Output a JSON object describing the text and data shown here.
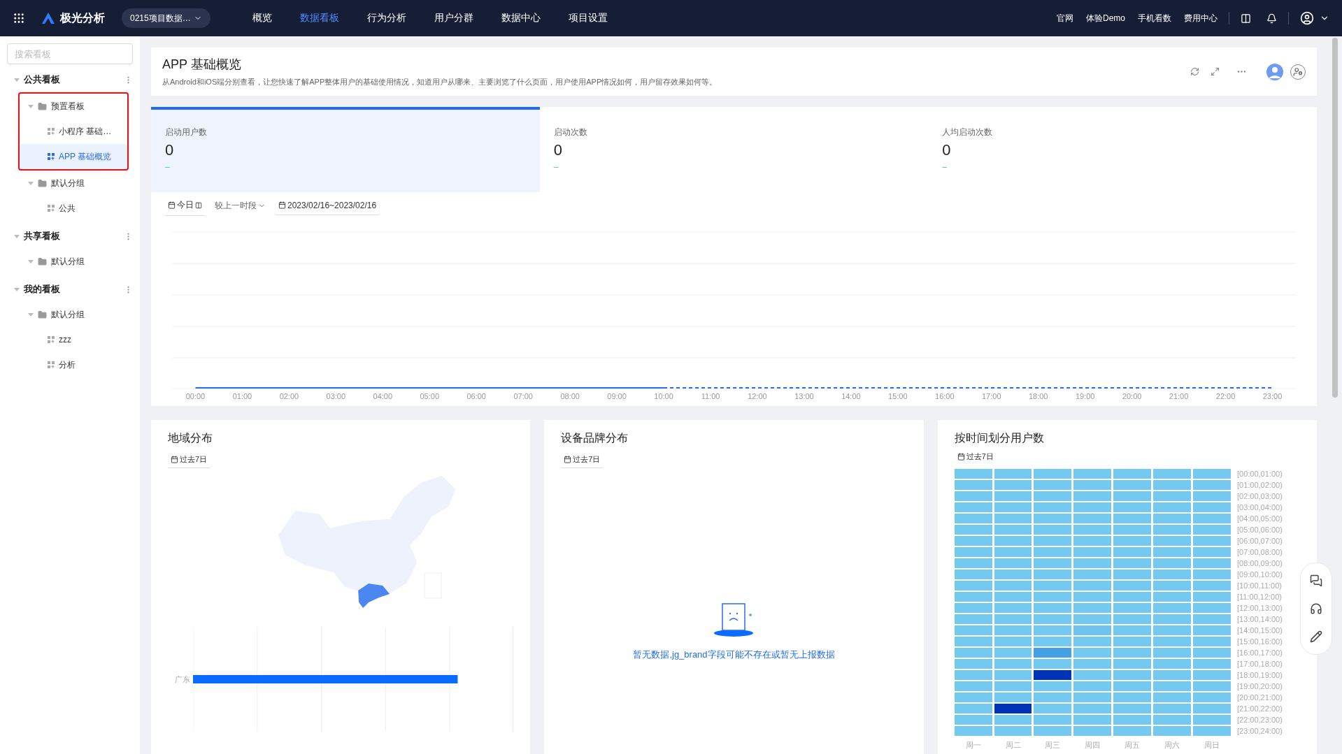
{
  "topbar": {
    "logo": "极光分析",
    "project": "0215项目数据…",
    "nav": [
      {
        "label": "概览",
        "selected": false
      },
      {
        "label": "数据看板",
        "selected": true
      },
      {
        "label": "行为分析",
        "selected": false
      },
      {
        "label": "用户分群",
        "selected": false
      },
      {
        "label": "数据中心",
        "selected": false
      },
      {
        "label": "项目设置",
        "selected": false
      }
    ],
    "links": [
      "官网",
      "体验Demo",
      "手机看数",
      "费用中心"
    ]
  },
  "sidebar": {
    "search_placeholder": "搜索看板",
    "sections": [
      {
        "title": "公共看板",
        "expanded": true,
        "children": [
          {
            "label": "预置看板",
            "kind": "folder",
            "expanded": true,
            "highlighted": true,
            "children": [
              {
                "label": "小程序 基础…",
                "kind": "board",
                "selected": false
              },
              {
                "label": "APP 基础概览",
                "kind": "board",
                "selected": true
              }
            ]
          },
          {
            "label": "默认分组",
            "kind": "folder",
            "expanded": true,
            "highlighted": false,
            "children": [
              {
                "label": "公共",
                "kind": "board",
                "selected": false
              }
            ]
          }
        ]
      },
      {
        "title": "共享看板",
        "expanded": true,
        "children": [
          {
            "label": "默认分组",
            "kind": "folder",
            "expanded": true,
            "highlighted": false
          }
        ]
      },
      {
        "title": "我的看板",
        "expanded": true,
        "children": [
          {
            "label": "默认分组",
            "kind": "folder",
            "expanded": true,
            "highlighted": false,
            "children": [
              {
                "label": "zzz",
                "kind": "board",
                "selected": false
              },
              {
                "label": "分析",
                "kind": "board",
                "selected": false
              }
            ]
          }
        ]
      }
    ]
  },
  "header": {
    "title": "APP 基础概览",
    "description": "从Android和iOS端分别查看，让您快速了解APP整体用户的基础使用情况，知道用户从哪来、主要浏览了什么页面，用户使用APP情况如何，用户留存效果如何等。"
  },
  "kpis": [
    {
      "label": "启动用户数",
      "value": "0",
      "change": "–",
      "selected": true
    },
    {
      "label": "启动次数",
      "value": "0",
      "change": "–",
      "selected": false
    },
    {
      "label": "人均启动次数",
      "value": "0",
      "change": "–",
      "selected": false
    }
  ],
  "filters": {
    "period": "今日",
    "compare": "较上一时段",
    "range": "2023/02/16~2023/02/16"
  },
  "trend": {
    "x_labels": [
      "00:00",
      "01:00",
      "02:00",
      "03:00",
      "04:00",
      "05:00",
      "06:00",
      "07:00",
      "08:00",
      "09:00",
      "10:00",
      "11:00",
      "12:00",
      "13:00",
      "14:00",
      "15:00",
      "16:00",
      "17:00",
      "18:00",
      "19:00",
      "20:00",
      "21:00",
      "22:00",
      "23:00"
    ]
  },
  "region": {
    "title": "地域分布",
    "period": "过去7日",
    "bar_label": "广东"
  },
  "brand": {
    "title": "设备品牌分布",
    "period": "过去7日",
    "empty_text": "暂无数据,jg_brand字段可能不存在或暂无上报数据"
  },
  "heatmap": {
    "title": "按时间划分用户数",
    "period": "过去7日",
    "days": [
      "周一",
      "周二",
      "周三",
      "周四",
      "周五",
      "周六",
      "周日"
    ],
    "rows": [
      {
        "label": "[00:00,01:00)",
        "cells": [
          {
            "color": "#73c9f0"
          },
          {
            "color": "#73c9f0"
          },
          {
            "color": "#73c9f0"
          },
          {
            "color": "#73c9f0"
          },
          {
            "color": "#73c9f0"
          },
          {
            "color": "#73c9f0"
          },
          {
            "color": "#73c9f0"
          }
        ]
      },
      {
        "label": "[01:00,02:00)",
        "cells": [
          {
            "color": "#73c9f0"
          },
          {
            "color": "#73c9f0"
          },
          {
            "color": "#73c9f0"
          },
          {
            "color": "#73c9f0"
          },
          {
            "color": "#73c9f0"
          },
          {
            "color": "#73c9f0"
          },
          {
            "color": "#73c9f0"
          }
        ]
      },
      {
        "label": "[02:00,03:00)",
        "cells": [
          {
            "color": "#73c9f0"
          },
          {
            "color": "#73c9f0"
          },
          {
            "color": "#73c9f0"
          },
          {
            "color": "#73c9f0"
          },
          {
            "color": "#73c9f0"
          },
          {
            "color": "#73c9f0"
          },
          {
            "color": "#73c9f0"
          }
        ]
      },
      {
        "label": "[03:00,04:00)",
        "cells": [
          {
            "color": "#73c9f0"
          },
          {
            "color": "#73c9f0"
          },
          {
            "color": "#73c9f0"
          },
          {
            "color": "#73c9f0"
          },
          {
            "color": "#73c9f0"
          },
          {
            "color": "#73c9f0"
          },
          {
            "color": "#73c9f0"
          }
        ]
      },
      {
        "label": "[04:00,05:00)",
        "cells": [
          {
            "color": "#73c9f0"
          },
          {
            "color": "#73c9f0"
          },
          {
            "color": "#73c9f0"
          },
          {
            "color": "#73c9f0"
          },
          {
            "color": "#73c9f0"
          },
          {
            "color": "#73c9f0"
          },
          {
            "color": "#73c9f0"
          }
        ]
      },
      {
        "label": "[05:00,06:00)",
        "cells": [
          {
            "color": "#73c9f0"
          },
          {
            "color": "#73c9f0"
          },
          {
            "color": "#73c9f0"
          },
          {
            "color": "#73c9f0"
          },
          {
            "color": "#73c9f0"
          },
          {
            "color": "#73c9f0"
          },
          {
            "color": "#73c9f0"
          }
        ]
      },
      {
        "label": "[06:00,07:00)",
        "cells": [
          {
            "color": "#73c9f0"
          },
          {
            "color": "#73c9f0"
          },
          {
            "color": "#73c9f0"
          },
          {
            "color": "#73c9f0"
          },
          {
            "color": "#73c9f0"
          },
          {
            "color": "#73c9f0"
          },
          {
            "color": "#73c9f0"
          }
        ]
      },
      {
        "label": "[07:00,08:00)",
        "cells": [
          {
            "color": "#73c9f0"
          },
          {
            "color": "#73c9f0"
          },
          {
            "color": "#73c9f0"
          },
          {
            "color": "#73c9f0"
          },
          {
            "color": "#73c9f0"
          },
          {
            "color": "#73c9f0"
          },
          {
            "color": "#73c9f0"
          }
        ]
      },
      {
        "label": "[08:00,09:00)",
        "cells": [
          {
            "color": "#73c9f0"
          },
          {
            "color": "#73c9f0"
          },
          {
            "color": "#73c9f0"
          },
          {
            "color": "#73c9f0"
          },
          {
            "color": "#73c9f0"
          },
          {
            "color": "#73c9f0"
          },
          {
            "color": "#73c9f0"
          }
        ]
      },
      {
        "label": "[09:00,10:00)",
        "cells": [
          {
            "color": "#73c9f0"
          },
          {
            "color": "#73c9f0"
          },
          {
            "color": "#73c9f0"
          },
          {
            "color": "#73c9f0"
          },
          {
            "color": "#73c9f0"
          },
          {
            "color": "#73c9f0"
          },
          {
            "color": "#73c9f0"
          }
        ]
      },
      {
        "label": "[10:00,11:00)",
        "cells": [
          {
            "color": "#73c9f0"
          },
          {
            "color": "#73c9f0"
          },
          {
            "color": "#73c9f0"
          },
          {
            "color": "#73c9f0"
          },
          {
            "color": "#73c9f0"
          },
          {
            "color": "#73c9f0"
          },
          {
            "color": "#73c9f0"
          }
        ]
      },
      {
        "label": "[11:00,12:00)",
        "cells": [
          {
            "color": "#73c9f0"
          },
          {
            "color": "#73c9f0"
          },
          {
            "color": "#73c9f0"
          },
          {
            "color": "#73c9f0"
          },
          {
            "color": "#73c9f0"
          },
          {
            "color": "#73c9f0"
          },
          {
            "color": "#73c9f0"
          }
        ]
      },
      {
        "label": "[12:00,13:00)",
        "cells": [
          {
            "color": "#73c9f0"
          },
          {
            "color": "#73c9f0"
          },
          {
            "color": "#73c9f0"
          },
          {
            "color": "#73c9f0"
          },
          {
            "color": "#73c9f0"
          },
          {
            "color": "#73c9f0"
          },
          {
            "color": "#73c9f0"
          }
        ]
      },
      {
        "label": "[13:00,14:00)",
        "cells": [
          {
            "color": "#73c9f0"
          },
          {
            "color": "#73c9f0"
          },
          {
            "color": "#73c9f0"
          },
          {
            "color": "#73c9f0"
          },
          {
            "color": "#73c9f0"
          },
          {
            "color": "#73c9f0"
          },
          {
            "color": "#73c9f0"
          }
        ]
      },
      {
        "label": "[14:00,15:00)",
        "cells": [
          {
            "color": "#73c9f0"
          },
          {
            "color": "#73c9f0"
          },
          {
            "color": "#73c9f0"
          },
          {
            "color": "#6ec4ee"
          },
          {
            "color": "#73c9f0"
          },
          {
            "color": "#73c9f0"
          },
          {
            "color": "#73c9f0"
          }
        ]
      },
      {
        "label": "[15:00,16:00)",
        "cells": [
          {
            "color": "#73c9f0"
          },
          {
            "color": "#73c9f0"
          },
          {
            "color": "#73c9f0"
          },
          {
            "color": "#73c9f0"
          },
          {
            "color": "#73c9f0"
          },
          {
            "color": "#73c9f0"
          },
          {
            "color": "#73c9f0"
          }
        ]
      },
      {
        "label": "[16:00,17:00)",
        "cells": [
          {
            "color": "#73c9f0"
          },
          {
            "color": "#73c9f0"
          },
          {
            "color": "#45a0e6"
          },
          {
            "color": "#73c9f0"
          },
          {
            "color": "#73c9f0"
          },
          {
            "color": "#73c9f0"
          },
          {
            "color": "#73c9f0"
          }
        ]
      },
      {
        "label": "[17:00,18:00)",
        "cells": [
          {
            "color": "#73c9f0"
          },
          {
            "color": "#73c9f0"
          },
          {
            "color": "#73c9f0"
          },
          {
            "color": "#73c9f0"
          },
          {
            "color": "#73c9f0"
          },
          {
            "color": "#73c9f0"
          },
          {
            "color": "#73c9f0"
          }
        ]
      },
      {
        "label": "[18:00,19:00)",
        "cells": [
          {
            "color": "#73c9f0"
          },
          {
            "color": "#73c9f0"
          },
          {
            "color": "#0033b8"
          },
          {
            "color": "#73c9f0"
          },
          {
            "color": "#73c9f0"
          },
          {
            "color": "#73c9f0"
          },
          {
            "color": "#73c9f0"
          }
        ]
      },
      {
        "label": "[19:00,20:00)",
        "cells": [
          {
            "color": "#73c9f0"
          },
          {
            "color": "#73c9f0"
          },
          {
            "color": "#73c9f0"
          },
          {
            "color": "#73c9f0"
          },
          {
            "color": "#73c9f0"
          },
          {
            "color": "#73c9f0"
          },
          {
            "color": "#73c9f0"
          }
        ]
      },
      {
        "label": "[20:00,21:00)",
        "cells": [
          {
            "color": "#73c9f0"
          },
          {
            "color": "#73c9f0"
          },
          {
            "color": "#73c9f0"
          },
          {
            "color": "#73c9f0"
          },
          {
            "color": "#73c9f0"
          },
          {
            "color": "#73c9f0"
          },
          {
            "color": "#73c9f0"
          }
        ]
      },
      {
        "label": "[21:00,22:00)",
        "cells": [
          {
            "color": "#73c9f0"
          },
          {
            "color": "#0033b8"
          },
          {
            "color": "#73c9f0"
          },
          {
            "color": "#73c9f0"
          },
          {
            "color": "#73c9f0"
          },
          {
            "color": "#73c9f0"
          },
          {
            "color": "#73c9f0"
          }
        ]
      },
      {
        "label": "[22:00,23:00)",
        "cells": [
          {
            "color": "#73c9f0"
          },
          {
            "color": "#73c9f0"
          },
          {
            "color": "#73c9f0"
          },
          {
            "color": "#73c9f0"
          },
          {
            "color": "#73c9f0"
          },
          {
            "color": "#73c9f0"
          },
          {
            "color": "#73c9f0"
          }
        ]
      },
      {
        "label": "[23:00,24:00)",
        "cells": [
          {
            "color": "#73c9f0"
          },
          {
            "color": "#73c9f0"
          },
          {
            "color": "#73c9f0"
          },
          {
            "color": "#73c9f0"
          },
          {
            "color": "#73c9f0"
          },
          {
            "color": "#73c9f0"
          },
          {
            "color": "#73c9f0"
          }
        ]
      }
    ]
  }
}
